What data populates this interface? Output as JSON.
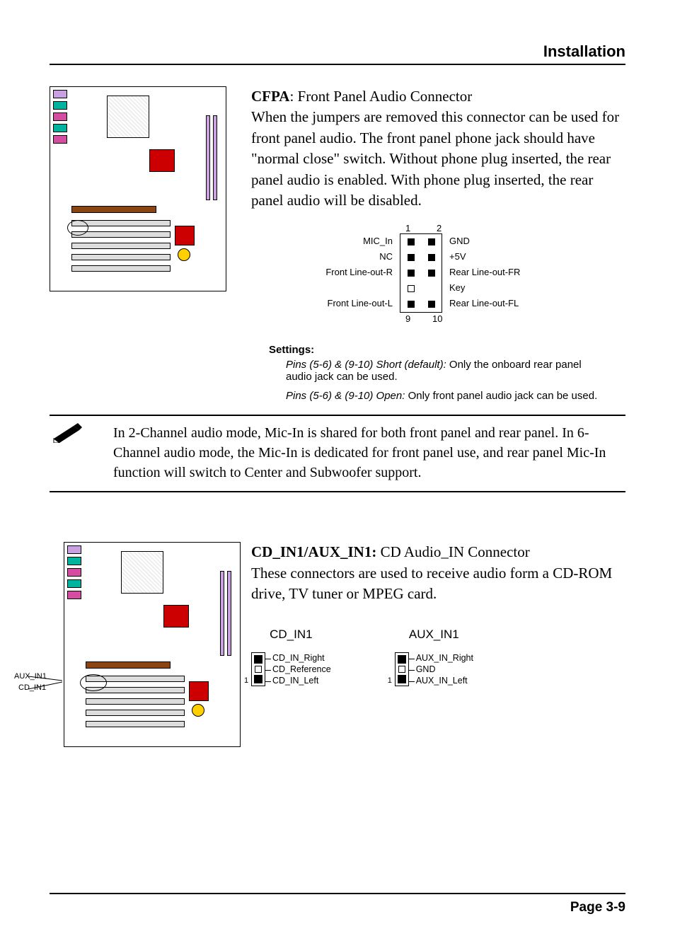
{
  "header": {
    "title": "Installation"
  },
  "footer": {
    "page_label": "Page 3-9"
  },
  "cfpa": {
    "name_bold": "CFPA",
    "name_rest": ":  Front Panel Audio Connector",
    "body": "When the jumpers are removed this connector can be used for front panel audio. The  front panel phone jack should have \"normal close\" switch. Without phone plug inserted, the rear panel audio is enabled. With phone plug inserted, the rear panel audio will be disabled.",
    "pins": {
      "num_top_left": "1",
      "num_top_right": "2",
      "num_bot_left": "9",
      "num_bot_right": "10",
      "left": [
        "MIC_In",
        "NC",
        "Front Line-out-R",
        "",
        "Front Line-out-L"
      ],
      "right": [
        "GND",
        "+5V",
        "Rear Line-out-FR",
        "Key",
        "Rear Line-out-FL"
      ]
    }
  },
  "settings": {
    "heading": "Settings:",
    "row1_em": "Pins (5-6) & (9-10) Short (default): ",
    "row1_rest": "Only the onboard rear panel audio jack can be used.",
    "row2_em": "Pins (5-6) & (9-10) Open: ",
    "row2_rest": "Only front panel audio jack can be used."
  },
  "note": {
    "text": "In 2-Channel audio mode, Mic-In is shared for both front panel and rear panel. In 6-Channel audio mode, the Mic-In is dedicated for front panel use, and rear panel Mic-In function will switch to Center and Subwoofer support."
  },
  "cdin": {
    "name_bold": "CD_IN1/AUX_IN1: ",
    "name_rest": "CD Audio_IN Connector",
    "body": "These connectors are used to receive audio form a CD-ROM drive, TV tuner or MPEG card.",
    "locator_labels": {
      "aux": "AUX_IN1",
      "cd": "CD_IN1"
    },
    "cd": {
      "title": "CD_IN1",
      "pins": [
        "CD_IN_Right",
        "CD_Reference",
        "CD_IN_Left"
      ],
      "pin1": "1"
    },
    "aux": {
      "title": "AUX_IN1",
      "pins": [
        "AUX_IN_Right",
        "GND",
        "AUX_IN_Left"
      ],
      "pin1": "1"
    }
  }
}
